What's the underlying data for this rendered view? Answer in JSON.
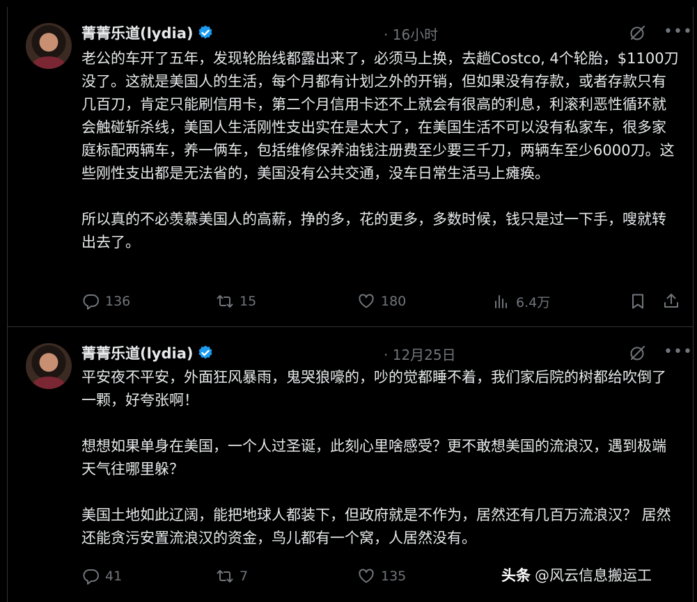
{
  "tweets": [
    {
      "author_name": "菁菁乐道(lydia)",
      "time": "· 16小时",
      "paragraphs": [
        "老公的车开了五年，发现轮胎线都露出来了，必须马上换，去趟Costco, 4个轮胎，$1100刀没了。这就是美国人的生活，每个月都有计划之外的开销，但如果没有存款，或者存款只有几百刀，肯定只能刷信用卡，第二个月信用卡还不上就会有很高的利息，利滚利恶性循环就会触碰斩杀线，美国人生活刚性支出实在是太大了，在美国生活不可以没有私家车，很多家庭标配两辆车，养一俩车，包括维修保养油钱注册费至少要三千刀，两辆车至少6000刀。这些刚性支出都是无法省的，美国没有公共交通，没车日常生活马上瘫痪。",
        "所以真的不必羡慕美国人的高薪，挣的多，花的更多，多数时候，钱只是过一下手，嗖就转出去了。"
      ],
      "stats": {
        "replies": "136",
        "reposts": "15",
        "likes": "180",
        "views": "6.4万"
      }
    },
    {
      "author_name": "菁菁乐道(lydia)",
      "time": "· 12月25日",
      "paragraphs": [
        "平安夜不平安，外面狂风暴雨，鬼哭狼嚎的，吵的觉都睡不着，我们家后院的树都给吹倒了一颗，好夸张啊！",
        "想想如果单身在美国，一个人过圣诞，此刻心里啥感受？更不敢想美国的流浪汉，遇到极端天气往哪里躲？",
        "美国土地如此辽阔，能把地球人都装下，但政府就是不作为，居然还有几百万流浪汉？ 居然还能贪污安置流浪汉的资金，鸟儿都有一个窝，人居然没有。"
      ],
      "stats": {
        "replies": "41",
        "reposts": "7",
        "likes": "135"
      }
    }
  ],
  "watermark": {
    "brand": "头条",
    "handle": "@风云信息搬运工"
  },
  "icons": {
    "verified": "verified-badge-icon",
    "grok": "grok-icon",
    "more": "more-icon",
    "reply": "reply-icon",
    "repost": "repost-icon",
    "like": "like-icon",
    "views": "views-icon",
    "bookmark": "bookmark-icon",
    "share": "share-icon"
  },
  "colors": {
    "background": "#000000",
    "text": "#e7e9ea",
    "muted": "#71767b",
    "verified": "#1d9bf0",
    "divider": "#2f3336"
  }
}
